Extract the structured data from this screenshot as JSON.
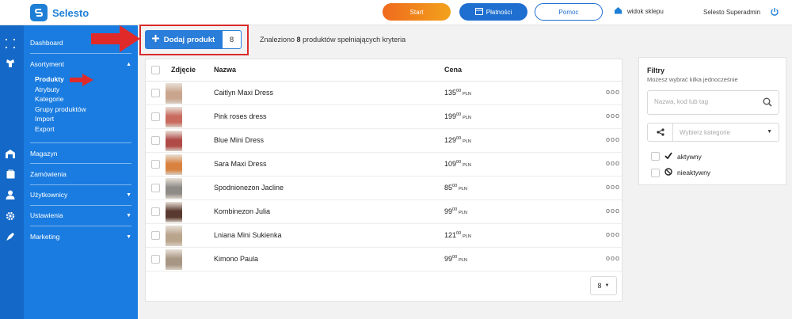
{
  "app": {
    "name": "Selesto"
  },
  "topbar": {
    "start_label": "Start",
    "payments_label": "Płatności",
    "help_label": "Pomoc",
    "view_shop_label": "widok sklepu",
    "user_label": "Selesto Superadmin"
  },
  "sidebar": {
    "dashboard": "Dashboard",
    "assortment": "Asortyment",
    "assortment_sub": [
      "Produkty",
      "Atrybuty",
      "Kategorie",
      "Grupy produktów",
      "Import",
      "Export"
    ],
    "warehouse": "Magazyn",
    "orders": "Zamówienia",
    "users": "Użytkownicy",
    "settings": "Ustawienia",
    "marketing": "Marketing"
  },
  "toolbar": {
    "add_label": "Dodaj produkt",
    "add_count": "8",
    "found_prefix": "Znaleziono",
    "found_count": "8",
    "found_suffix": "produktów spełniających kryteria"
  },
  "table": {
    "columns": {
      "photo": "Zdjęcie",
      "name": "Nazwa",
      "price": "Cena"
    },
    "rows": [
      {
        "name": "Caitlyn Maxi Dress",
        "price_int": "135",
        "price_dec": "00",
        "currency": "PLN",
        "thumb_color": "#c9a58d"
      },
      {
        "name": "Pink roses dress",
        "price_int": "199",
        "price_dec": "00",
        "currency": "PLN",
        "thumb_color": "#c96a5e"
      },
      {
        "name": "Blue Mini Dress",
        "price_int": "129",
        "price_dec": "00",
        "currency": "PLN",
        "thumb_color": "#b04a47"
      },
      {
        "name": "Sara Maxi Dress",
        "price_int": "109",
        "price_dec": "00",
        "currency": "PLN",
        "thumb_color": "#d9823f"
      },
      {
        "name": "Spodnionezon Jacline",
        "price_int": "85",
        "price_dec": "00",
        "currency": "PLN",
        "thumb_color": "#8e8a86"
      },
      {
        "name": "Kombinezon Julia",
        "price_int": "99",
        "price_dec": "00",
        "currency": "PLN",
        "thumb_color": "#5a3a30"
      },
      {
        "name": "Lniana Mini Sukienka",
        "price_int": "121",
        "price_dec": "00",
        "currency": "PLN",
        "thumb_color": "#b9a48c"
      },
      {
        "name": "Kimono Paula",
        "price_int": "99",
        "price_dec": "00",
        "currency": "PLN",
        "thumb_color": "#a79684"
      }
    ],
    "row_menu": "ooo",
    "per_page": "8"
  },
  "filters": {
    "title": "Filtry",
    "subtitle": "Możesz wybrać kilka jednocześnie",
    "search_placeholder": "Nazwa, kod lub tag",
    "category_placeholder": "Wybierz kategorie",
    "active_label": "aktywny",
    "inactive_label": "nieaktywny"
  },
  "colors": {
    "accent": "#1a7ce0",
    "rail": "#1468c7",
    "highlight": "#d92b2b"
  }
}
